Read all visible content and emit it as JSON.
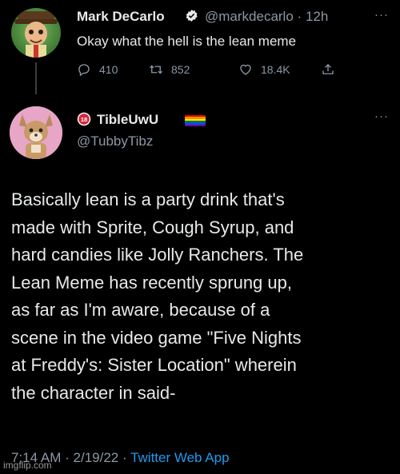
{
  "tweet1": {
    "author_name": "Mark DeCarlo",
    "handle": "@markdecarlo",
    "separator": "·",
    "time": "12h",
    "more": "···",
    "text": "Okay what the hell is the lean meme",
    "replies": "410",
    "retweets": "852",
    "likes": "18.4K",
    "icons": [
      "reply-icon",
      "retweet-icon",
      "like-icon",
      "share-icon",
      "verified-icon"
    ],
    "verified_color": "#e7e9ea"
  },
  "tweet2": {
    "author_name": "TibleUwU",
    "age_badge": "18",
    "handle": "@TubbyTibz",
    "more": "···",
    "body_lines": [
      "Basically lean is a party drink that's",
      "made with Sprite, Cough Syrup, and",
      "hard candies like Jolly Ranchers. The",
      "Lean Meme has recently sprung up,",
      "as far as I'm aware, because of a",
      "scene in the video game \"Five Nights",
      "at Freddy's: Sister Location\" wherein",
      "the character in said-"
    ],
    "time": "7:14 AM",
    "separator1": "·",
    "date": "2/19/22",
    "separator2": "·",
    "app": "Twitter Web App",
    "pride_flag_colors": [
      "#e40303",
      "#ff8c00",
      "#ffed00",
      "#008026",
      "#004dff",
      "#750787"
    ]
  },
  "watermark": "imgflip.com",
  "colors": {
    "background": "#000000",
    "primary_text": "#e7e9ea",
    "secondary_text": "#8b98a5",
    "link": "#1d9bf0"
  }
}
